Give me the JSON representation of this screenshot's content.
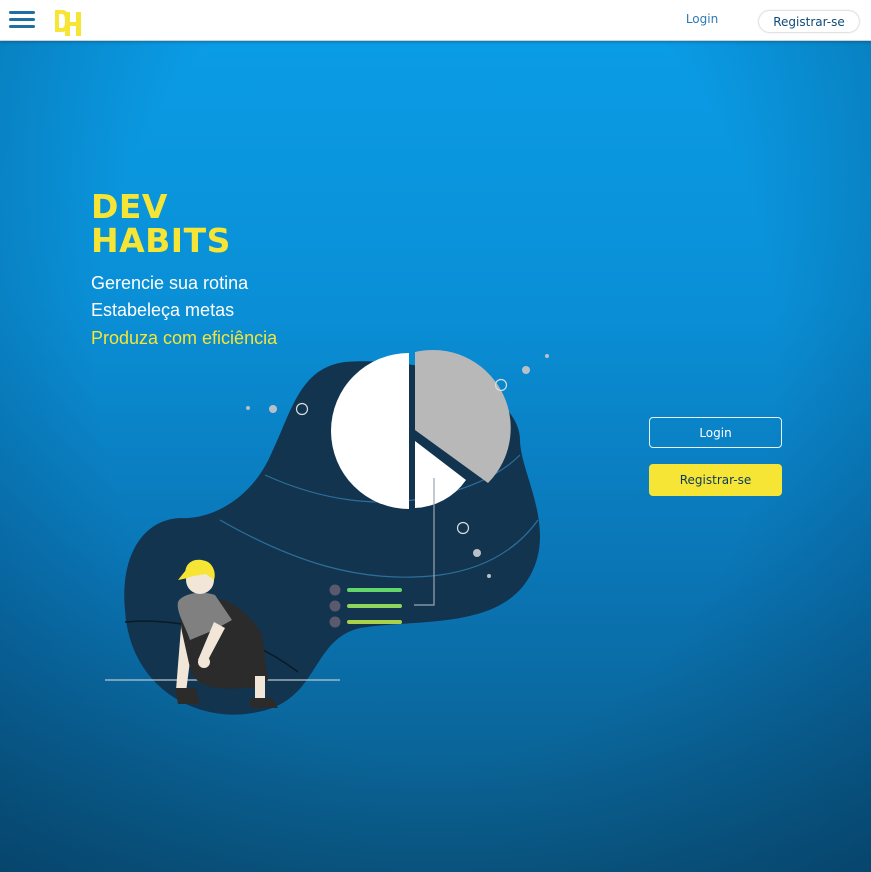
{
  "navbar": {
    "login_label": "Login",
    "register_label": "Registrar-se",
    "logo_icon": "dh-logo-icon",
    "menu_icon": "hamburger-menu-icon"
  },
  "hero": {
    "title_line1": "DEV",
    "title_line2": "HABITS",
    "taglines": [
      "Gerencie sua rotina",
      "Estabeleça metas",
      "Produza com eficiência"
    ]
  },
  "actions": {
    "login_label": "Login",
    "register_label": "Registrar-se"
  },
  "colors": {
    "accent": "#f7e536",
    "background_top": "#0a9ee8",
    "background_bottom": "#0a5a86",
    "blob": "#12344f",
    "check_lines": [
      "#63d66b",
      "#8fd45c",
      "#a9d24a"
    ]
  }
}
